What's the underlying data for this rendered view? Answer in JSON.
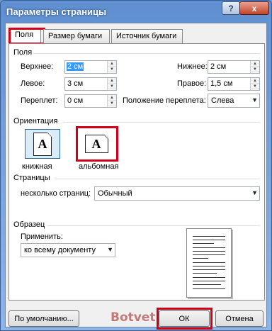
{
  "window": {
    "title": "Параметры страницы"
  },
  "titlebar": {
    "help_label": "?",
    "close_label": "x"
  },
  "tabs": [
    {
      "label": "Поля",
      "active": true
    },
    {
      "label": "Размер бумаги",
      "active": false
    },
    {
      "label": "Источник бумаги",
      "active": false
    }
  ],
  "margins": {
    "section_label": "Поля",
    "top": {
      "label": "Верхнее:",
      "value": "2 см"
    },
    "bottom": {
      "label": "Нижнее:",
      "value": "2 см"
    },
    "left": {
      "label": "Левое:",
      "value": "3 см"
    },
    "right": {
      "label": "Правое:",
      "value": "1,5 см"
    },
    "gutter": {
      "label": "Переплет:",
      "value": "0 см"
    },
    "gutter_position": {
      "label": "Положение переплета:",
      "value": "Слева"
    }
  },
  "orientation": {
    "section_label": "Ориентация",
    "portrait_label": "книжная",
    "landscape_label": "альбомная",
    "icon_glyph": "A"
  },
  "pages": {
    "section_label": "Страницы",
    "multiple_label": "несколько страниц:",
    "multiple_value": "Обычный"
  },
  "sample": {
    "section_label": "Образец",
    "apply_label": "Применить:",
    "apply_value": "ко всему документу"
  },
  "footer": {
    "default_label": "По умолчанию...",
    "ok_label": "ОК",
    "cancel_label": "Отмена",
    "watermark": "Botvet.ru"
  },
  "colors": {
    "highlight_box": "#d0001a",
    "title_bar": "#5f8fd0",
    "selection": "#3399ff"
  }
}
